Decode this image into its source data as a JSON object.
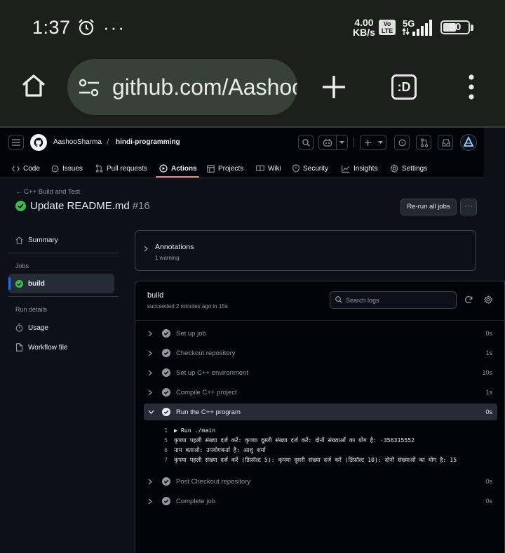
{
  "status_bar": {
    "time": "1:37",
    "overflow": "···",
    "net_speed_value": "4.00",
    "net_speed_unit": "KB/s",
    "volte_line1": "Vo",
    "volte_line2": "LTE",
    "network": "5G",
    "battery": "50"
  },
  "browser": {
    "url": "github.com/AashooSharma/hindi-programming/actions",
    "tabs_label": ":D"
  },
  "github": {
    "owner": "AashooSharma",
    "separator": "/",
    "repo": "hindi-programming",
    "nav_tabs": [
      {
        "label": "Code"
      },
      {
        "label": "Issues"
      },
      {
        "label": "Pull requests"
      },
      {
        "label": "Actions"
      },
      {
        "label": "Projects"
      },
      {
        "label": "Wiki"
      },
      {
        "label": "Security"
      },
      {
        "label": "Insights"
      },
      {
        "label": "Settings"
      }
    ],
    "active_tab": "Actions",
    "workflow_name": "C++ Build and Test",
    "run_title": "Update README.md",
    "run_number": "#16",
    "rerun_label": "Re-run all jobs",
    "more_label": "···",
    "sidebar": {
      "summary": "Summary",
      "jobs_heading": "Jobs",
      "job": "build",
      "run_details_heading": "Run details",
      "usage": "Usage",
      "workflow_file": "Workflow file"
    },
    "annotations": {
      "title": "Annotations",
      "subtitle": "1 warning"
    },
    "job": {
      "title": "build",
      "subtitle": "succeeded 2 minutes ago in 15s",
      "search_placeholder": "Search logs",
      "steps": [
        {
          "name": "Set up job",
          "duration": "0s"
        },
        {
          "name": "Checkout repository",
          "duration": "1s"
        },
        {
          "name": "Set up C++ environment",
          "duration": "10s"
        },
        {
          "name": "Compile C++ project",
          "duration": "1s"
        },
        {
          "name": "Run the C++ program",
          "duration": "0s"
        },
        {
          "name": "Post Checkout repository",
          "duration": "0s"
        },
        {
          "name": "Complete job",
          "duration": "0s"
        }
      ],
      "log_lines": [
        {
          "num": "1",
          "text": "▶ Run ./main"
        },
        {
          "num": "5",
          "text": "कृपया पहली संख्या दर्ज करें: कृपया दूसरी संख्या दर्ज करें: दोनों संख्याओं का योग है: -356315552"
        },
        {
          "num": "6",
          "text": "नाम बताओ: उपयोगकर्ता है: आशु शर्मा"
        },
        {
          "num": "7",
          "text": "कृपया पहली संख्या दर्ज करें (डिफ़ॉल्ट 5): कृपया दूसरी संख्या दर्ज करें (डिफ़ॉल्ट 10): दोनों संख्याओं का योग है: 15"
        }
      ]
    }
  },
  "colors": {
    "page_bg": "#0d1117",
    "header_bg": "#010409",
    "success": "#3fb950",
    "accent_underline": "#f78166",
    "url_pill": "#364238"
  }
}
